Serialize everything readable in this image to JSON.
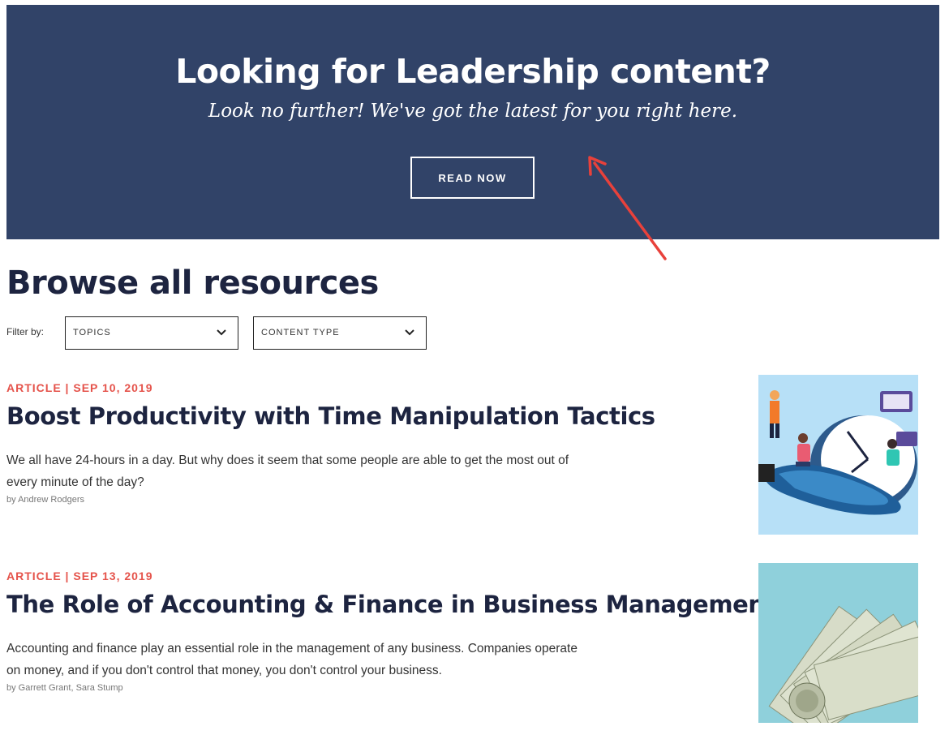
{
  "hero": {
    "title": "Looking for Leadership content?",
    "subtitle": "Look no further! We've got the latest for you right here.",
    "button_label": "READ NOW",
    "background": "#314368"
  },
  "browse": {
    "title": "Browse all resources",
    "filter_label": "Filter by:",
    "filters": [
      {
        "label": "TOPICS",
        "icon": "chevron-down-icon"
      },
      {
        "label": "CONTENT TYPE",
        "icon": "chevron-down-icon"
      }
    ]
  },
  "articles": [
    {
      "meta": "ARTICLE | SEP 10, 2019",
      "title": "Boost Productivity with Time Manipulation Tactics",
      "description": "We all have 24-hours in a day. But why does it seem that some people are able to get the most out of every minute of the day?",
      "author": "by Andrew Rodgers",
      "image": "clock-productivity-illustration"
    },
    {
      "meta": "ARTICLE | SEP 13, 2019",
      "title": "The Role of Accounting & Finance in Business Management",
      "description": "Accounting and finance play an essential role in the management of any business. Companies operate on money, and if you don't control that money, you don't control your business.",
      "author": "by Garrett Grant, Sara Stump",
      "image": "dollar-bills-photo"
    }
  ],
  "colors": {
    "accent": "#e5534b",
    "heading": "#1d2440",
    "annotation_arrow": "#e8413b"
  }
}
